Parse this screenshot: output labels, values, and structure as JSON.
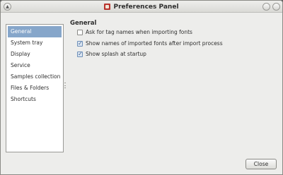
{
  "window": {
    "title": "Preferences Panel"
  },
  "sidebar": {
    "items": [
      {
        "label": "General",
        "selected": true
      },
      {
        "label": "System tray",
        "selected": false
      },
      {
        "label": "Display",
        "selected": false
      },
      {
        "label": "Service",
        "selected": false
      },
      {
        "label": "Samples collection",
        "selected": false
      },
      {
        "label": "Files & Folders",
        "selected": false
      },
      {
        "label": "Shortcuts",
        "selected": false
      }
    ]
  },
  "general": {
    "section_title": "General",
    "options": [
      {
        "label": "Ask for tag names when importing fonts",
        "checked": false
      },
      {
        "label": "Show names of imported fonts after import process",
        "checked": true
      },
      {
        "label": "Show splash at startup",
        "checked": true
      }
    ]
  },
  "footer": {
    "close_label": "Close"
  },
  "colors": {
    "selection": "#86a6ca",
    "window_bg": "#ededeb"
  }
}
